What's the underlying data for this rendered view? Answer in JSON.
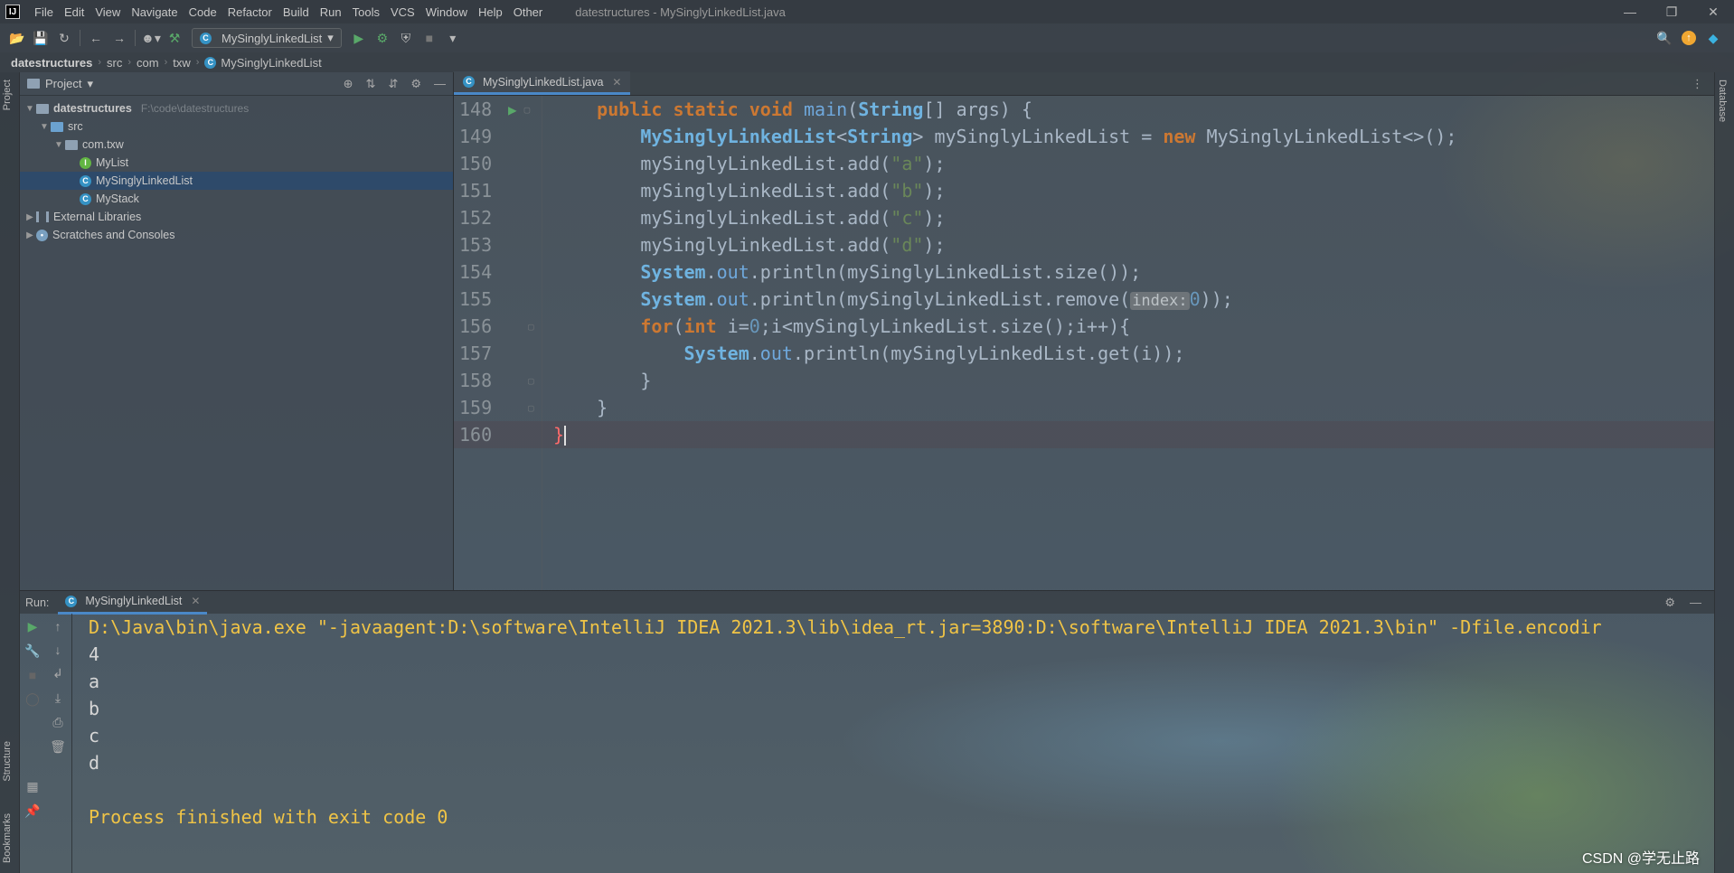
{
  "app": {
    "logo_text": "IJ",
    "window_title": "datestructures - MySinglyLinkedList.java",
    "menu": [
      "File",
      "Edit",
      "View",
      "Navigate",
      "Code",
      "Refactor",
      "Build",
      "Run",
      "Tools",
      "VCS",
      "Window",
      "Help",
      "Other"
    ]
  },
  "toolbar": {
    "run_config": "MySinglyLinkedList"
  },
  "breadcrumb": [
    "datestructures",
    "src",
    "com",
    "txw",
    "MySinglyLinkedList"
  ],
  "stripes": {
    "left_top": "Project",
    "left_mid": "Structure",
    "left_bottom": "Bookmarks",
    "right_top": "Database"
  },
  "project_panel": {
    "title": "Project",
    "tree": [
      {
        "label": "datestructures",
        "path": "F:\\code\\datestructures",
        "level": 0,
        "type": "project"
      },
      {
        "label": "src",
        "level": 1,
        "type": "source"
      },
      {
        "label": "com.txw",
        "level": 2,
        "type": "package"
      },
      {
        "label": "MyList",
        "level": 3,
        "type": "interface"
      },
      {
        "label": "MySinglyLinkedList",
        "level": 3,
        "type": "class",
        "selected": true
      },
      {
        "label": "MyStack",
        "level": 3,
        "type": "class"
      },
      {
        "label": "External Libraries",
        "level": 0,
        "type": "library"
      },
      {
        "label": "Scratches and Consoles",
        "level": 0,
        "type": "scratch"
      }
    ]
  },
  "editor": {
    "tab_label": "MySinglyLinkedList.java",
    "lines": [
      {
        "num": "148"
      },
      {
        "num": "149"
      },
      {
        "num": "150"
      },
      {
        "num": "151"
      },
      {
        "num": "152"
      },
      {
        "num": "153"
      },
      {
        "num": "154"
      },
      {
        "num": "155"
      },
      {
        "num": "156"
      },
      {
        "num": "157"
      },
      {
        "num": "158"
      },
      {
        "num": "159"
      },
      {
        "num": "160"
      }
    ],
    "code": {
      "l148": {
        "kw1": "public",
        "kw2": "static",
        "kw3": "void",
        "fn": "main",
        "p1": "(",
        "ty": "String",
        "p2": "[] args) {"
      },
      "l149": {
        "ty1": "MySinglyLinkedList",
        "p1": "<",
        "ty2": "String",
        "p2": "> mySinglyLinkedList = ",
        "kw": "new",
        "p3": " MySinglyLinkedList<>();"
      },
      "l150": {
        "p1": "mySinglyLinkedList.add(",
        "st": "\"a\"",
        "p2": ");"
      },
      "l151": {
        "p1": "mySinglyLinkedList.add(",
        "st": "\"b\"",
        "p2": ");"
      },
      "l152": {
        "p1": "mySinglyLinkedList.add(",
        "st": "\"c\"",
        "p2": ");"
      },
      "l153": {
        "p1": "mySinglyLinkedList.add(",
        "st": "\"d\"",
        "p2": ");"
      },
      "l154": {
        "ty": "System",
        "p1": ".",
        "fld": "out",
        "p2": ".println(mySinglyLinkedList.size());"
      },
      "l155": {
        "ty": "System",
        "p1": ".",
        "fld": "out",
        "p2": ".println(mySinglyLinkedList.remove(",
        "hint": "index:",
        "num": "0",
        "p3": "));"
      },
      "l156": {
        "kw": "for",
        "p1": "(",
        "kw2": "int",
        "p2": " i=",
        "num": "0",
        "p3": ";i<mySinglyLinkedList.size();i++){"
      },
      "l157": {
        "ty": "System",
        "p1": ".",
        "fld": "out",
        "p2": ".println(mySinglyLinkedList.get(i));"
      },
      "l158": {
        "p1": "}"
      },
      "l159": {
        "p1": "}"
      },
      "l160": {
        "p1": "}"
      }
    }
  },
  "run_panel": {
    "label": "Run:",
    "tab_label": "MySinglyLinkedList",
    "output": [
      "D:\\Java\\bin\\java.exe \"-javaagent:D:\\software\\IntelliJ IDEA 2021.3\\lib\\idea_rt.jar=3890:D:\\software\\IntelliJ IDEA 2021.3\\bin\" -Dfile.encodir",
      "4",
      "a",
      "b",
      "c",
      "d",
      "",
      "Process finished with exit code 0"
    ]
  },
  "watermark": "CSDN @学无止路",
  "colors": {
    "accent": "#4a88c7",
    "keyword": "#cc7832",
    "string": "#6a8759",
    "number": "#6897bb",
    "console_highlight": "#f0c446"
  }
}
